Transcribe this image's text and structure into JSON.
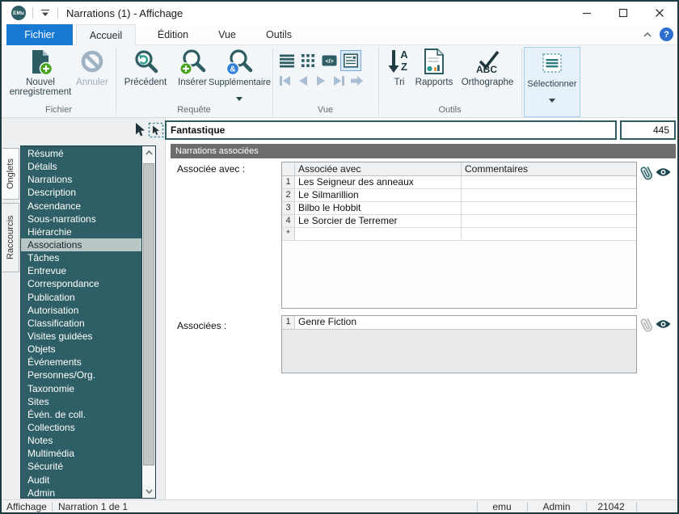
{
  "titlebar": {
    "logo": "EMu",
    "title": "Narrations (1) - Affichage"
  },
  "menu": {
    "tabs": [
      "Fichier",
      "Accueil",
      "Édition",
      "Vue",
      "Outils"
    ],
    "help": "?"
  },
  "ribbon": {
    "group_labels": {
      "file": "Fichier",
      "query": "Requête",
      "view": "Vue",
      "tools": "Outils"
    },
    "buttons": {
      "new_record_line1": "Nouvel",
      "new_record_line2": "enregistrement",
      "cancel": "Annuler",
      "previous": "Précédent",
      "insert": "Insérer",
      "additional": "Supplémentaire",
      "sort": "Tri",
      "reports": "Rapports",
      "spelling": "Orthographe",
      "select": "Sélectionner"
    },
    "icon_text": {
      "ampersand": "&",
      "code": "</>",
      "sort_a": "A",
      "sort_z": "Z",
      "spelling_abc": "ABC"
    }
  },
  "sidebar": {
    "vertical_tabs": [
      "Onglets",
      "Raccourcis"
    ],
    "items": [
      {
        "label": "Résumé"
      },
      {
        "label": "Détails"
      },
      {
        "label": "Narrations"
      },
      {
        "label": "Description"
      },
      {
        "label": "Ascendance"
      },
      {
        "label": "Sous-narrations"
      },
      {
        "label": "Hiérarchie"
      },
      {
        "label": "Associations",
        "selected": true
      },
      {
        "label": "Tâches"
      },
      {
        "label": "Entrevue"
      },
      {
        "label": "Correspondance"
      },
      {
        "label": "Publication"
      },
      {
        "label": "Autorisation"
      },
      {
        "label": "Classification"
      },
      {
        "label": "Visites guidées"
      },
      {
        "label": "Objets"
      },
      {
        "label": "Événements"
      },
      {
        "label": "Personnes/Org."
      },
      {
        "label": "Taxonomie"
      },
      {
        "label": "Sites"
      },
      {
        "label": "Évén. de coll."
      },
      {
        "label": "Collections"
      },
      {
        "label": "Notes"
      },
      {
        "label": "Multimédia"
      },
      {
        "label": "Sécurité"
      },
      {
        "label": "Audit"
      },
      {
        "label": "Admin"
      }
    ]
  },
  "content": {
    "record_title": "Fantastique",
    "record_number": "445",
    "section_title": "Narrations associées",
    "associated_with": {
      "label": "Associée avec :",
      "col_value": "Associée avec",
      "col_comment": "Commentaires",
      "rows": [
        {
          "n": "1",
          "value": "Les Seigneur des anneaux",
          "comment": ""
        },
        {
          "n": "2",
          "value": "Le Silmarillion",
          "comment": ""
        },
        {
          "n": "3",
          "value": "Bilbo le Hobbit",
          "comment": ""
        },
        {
          "n": "4",
          "value": "Le Sorcier de Terremer",
          "comment": ""
        },
        {
          "n": "*",
          "value": "",
          "comment": ""
        }
      ]
    },
    "associated": {
      "label": "Associées :",
      "rows": [
        {
          "n": "1",
          "value": "Genre Fiction"
        }
      ]
    }
  },
  "statusbar": {
    "mode": "Affichage",
    "position": "Narration 1 de 1",
    "connection": "emu",
    "user": "Admin",
    "port": "21042"
  },
  "colors": {
    "accent_teal": "#2e5e64",
    "tab_blue": "#1879d2",
    "selection_bg": "#b8c6c6",
    "section_header_bg": "#6d6d6d",
    "disabled_arrow": "#a9bdd5",
    "green_plus": "#45a41c"
  }
}
